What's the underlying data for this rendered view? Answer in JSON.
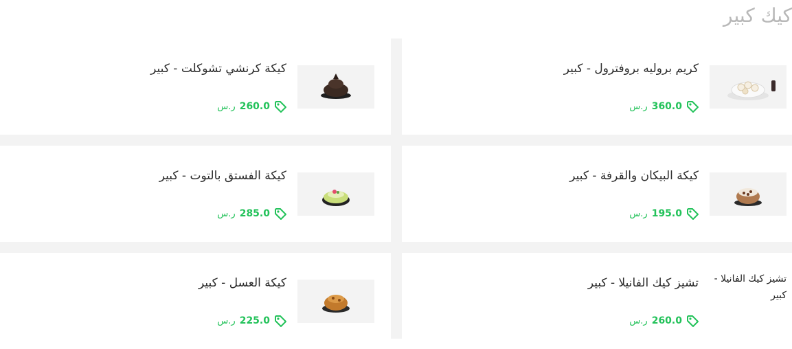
{
  "section": {
    "title": "كيك كبير"
  },
  "products": [
    {
      "name": "كريم بروليه بروفترول - كبير",
      "price": "360.0",
      "currency": "ر.س",
      "image": "profiterole-cake"
    },
    {
      "name": "كيكة كرنشي تشوكلت - كبير",
      "price": "260.0",
      "currency": "ر.س",
      "image": "chocolate-cake"
    },
    {
      "name": "كيكة البيكان والقرفة - كبير",
      "price": "195.0",
      "currency": "ر.س",
      "image": "pecan-cake"
    },
    {
      "name": "كيكة الفستق بالتوت - كبير",
      "price": "285.0",
      "currency": "ر.س",
      "image": "pistachio-cake"
    },
    {
      "name": "تشيز كيك الفانيلا - كبير",
      "price": "260.0",
      "currency": "ر.س",
      "image_alt": "تشيز كيك الفانيلا - كبير"
    },
    {
      "name": "كيكة العسل - كبير",
      "price": "225.0",
      "currency": "ر.س",
      "image": "honey-cake"
    }
  ],
  "colors": {
    "price": "#23c25a",
    "title": "#b8b8b8",
    "gap": "#f3f3f3"
  }
}
